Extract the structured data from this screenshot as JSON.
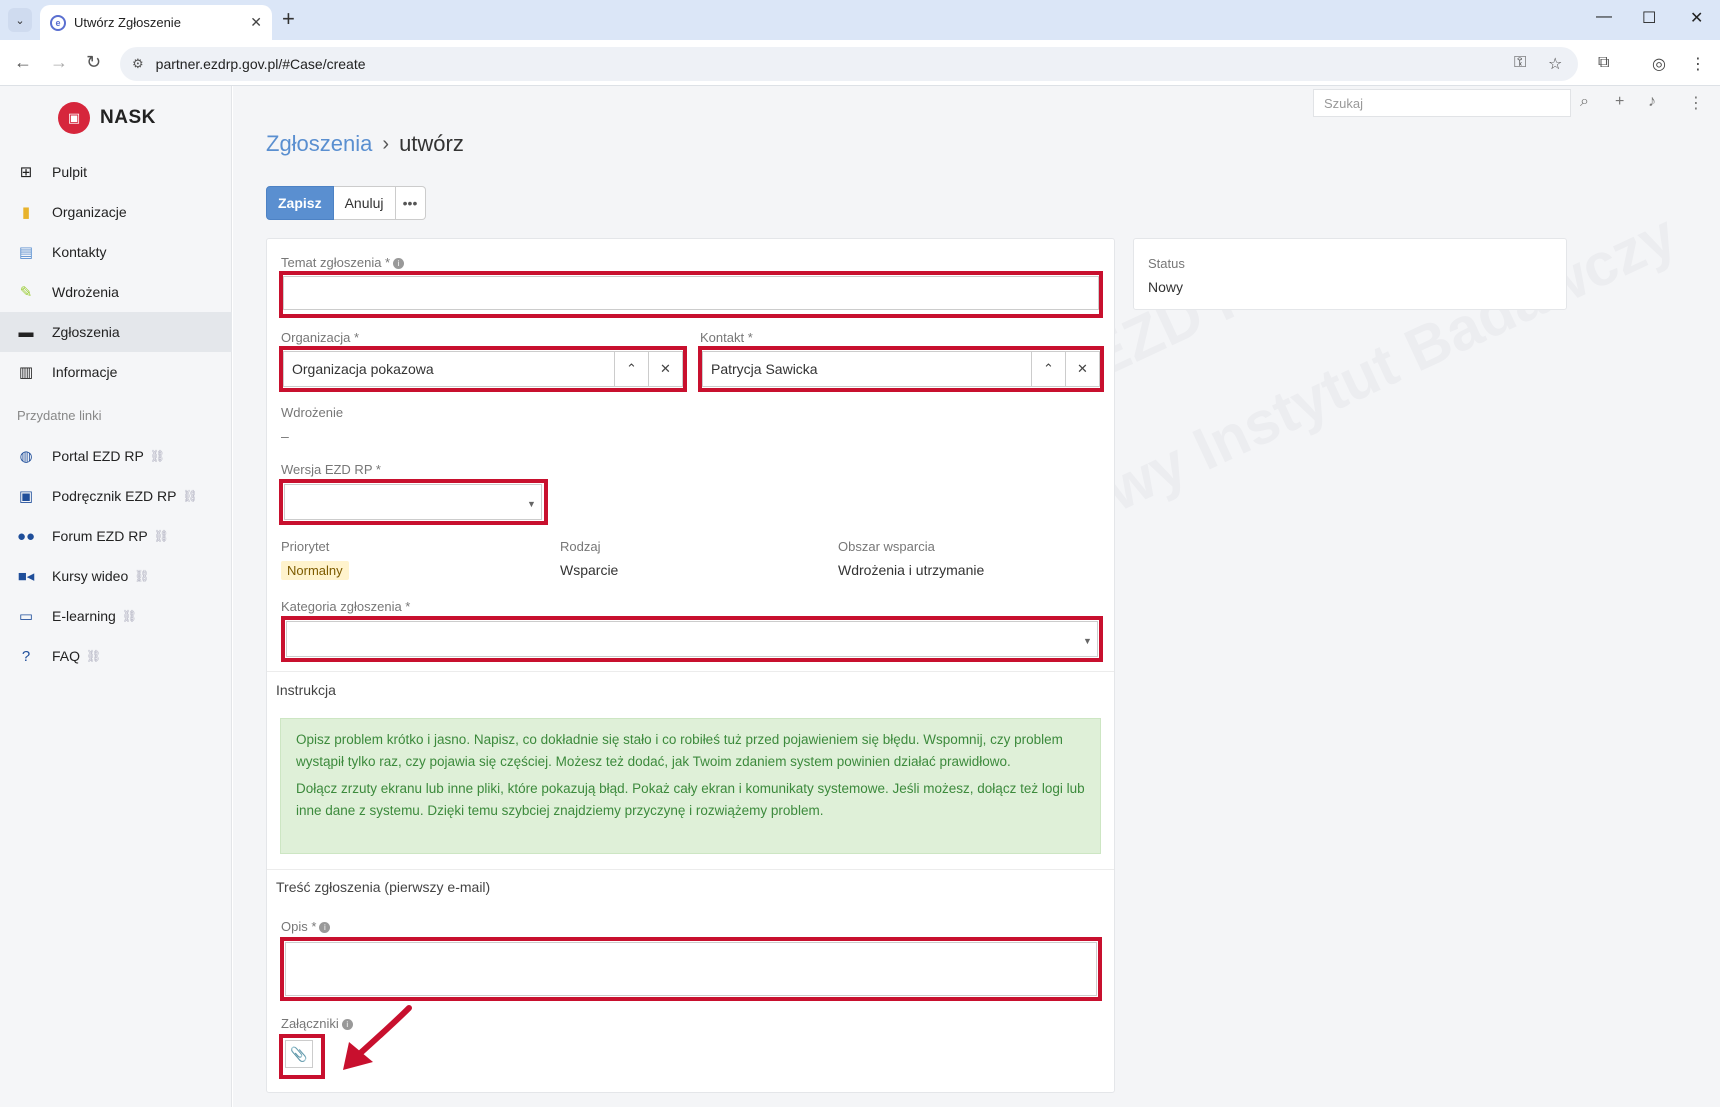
{
  "browser": {
    "tab_title": "Utwórz Zgłoszenie",
    "url": "partner.ezdrp.gov.pl/#Case/create"
  },
  "sidebar": {
    "logo": "NASK",
    "items": [
      {
        "label": "Pulpit",
        "icon": "grid-icon"
      },
      {
        "label": "Organizacje",
        "icon": "building-icon"
      },
      {
        "label": "Kontakty",
        "icon": "contact-icon"
      },
      {
        "label": "Wdrożenia",
        "icon": "pencil-icon"
      },
      {
        "label": "Zgłoszenia",
        "icon": "briefcase-icon"
      },
      {
        "label": "Informacje",
        "icon": "book-icon"
      }
    ],
    "section_title": "Przydatne linki",
    "links": [
      {
        "label": "Portal EZD RP",
        "icon": "globe-icon"
      },
      {
        "label": "Podręcznik EZD RP",
        "icon": "manual-icon"
      },
      {
        "label": "Forum EZD RP",
        "icon": "users-icon"
      },
      {
        "label": "Kursy wideo",
        "icon": "video-icon"
      },
      {
        "label": "E-learning",
        "icon": "monitor-icon"
      },
      {
        "label": "FAQ",
        "icon": "question-icon"
      }
    ]
  },
  "header": {
    "search_placeholder": "Szukaj"
  },
  "breadcrumb": {
    "parent": "Zgłoszenia",
    "separator": "›",
    "current": "utwórz"
  },
  "toolbar": {
    "save_label": "Zapisz",
    "cancel_label": "Anuluj",
    "more_label": "•••"
  },
  "form": {
    "subject_label": "Temat zgłoszenia *",
    "organization_label": "Organizacja *",
    "organization_value": "Organizacja pokazowa",
    "contact_label": "Kontakt *",
    "contact_value": "Patrycja Sawicka",
    "deployment_label": "Wdrożenie",
    "deployment_value": "–",
    "version_label": "Wersja EZD RP *",
    "priority_label": "Priorytet",
    "priority_value": "Normalny",
    "type_label": "Rodzaj",
    "type_value": "Wsparcie",
    "area_label": "Obszar wsparcia",
    "area_value": "Wdrożenia i utrzymanie",
    "category_label": "Kategoria zgłoszenia *",
    "instruction_title": "Instrukcja",
    "instruction_p1": "Opisz problem krótko i jasno. Napisz, co dokładnie się stało i co robiłeś tuż przed pojawieniem się błędu. Wspomnij, czy problem wystąpił tylko raz, czy pojawia się częściej. Możesz też dodać, jak Twoim zdaniem system powinien działać prawidłowo.",
    "instruction_p2": "Dołącz zrzuty ekranu lub inne pliki, które pokazują błąd. Pokaż cały ekran i komunikaty systemowe. Jeśli możesz, dołącz też logi lub inne dane z systemu. Dzięki temu szybciej znajdziemy przyczynę i rozwiążemy problem.",
    "content_title": "Treść zgłoszenia (pierwszy e-mail)",
    "description_label": "Opis *",
    "attachments_label": "Załączniki"
  },
  "status": {
    "label": "Status",
    "value": "Nowy"
  },
  "colors": {
    "primary": "#5a8fd0",
    "highlight": "#c8102e",
    "instruction_bg": "#dff0d8",
    "instruction_text": "#3c8a3c",
    "priority_badge": "#fff3cd"
  },
  "watermark": {
    "line1": "NASK – Państwowy Instytut Badawczy",
    "line2": "EZD RP"
  }
}
